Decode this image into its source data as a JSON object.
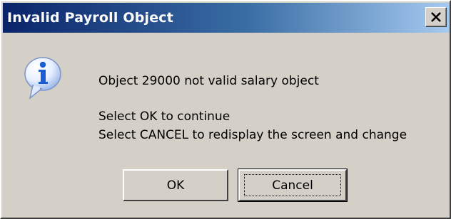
{
  "window": {
    "title": "Invalid Payroll Object",
    "close_icon": "close-icon"
  },
  "icon": "info-icon",
  "message": {
    "main": "Object 29000 not valid salary object",
    "line1": "Select OK to continue",
    "line2": "Select CANCEL to redisplay the screen and change"
  },
  "buttons": {
    "ok_label": "OK",
    "cancel_label": "Cancel"
  },
  "colors": {
    "title_bar_start": "#0a246a",
    "title_bar_end": "#a6caf0",
    "dialog_background": "#d4d0c8",
    "icon_blue": "#1a5bd6"
  }
}
